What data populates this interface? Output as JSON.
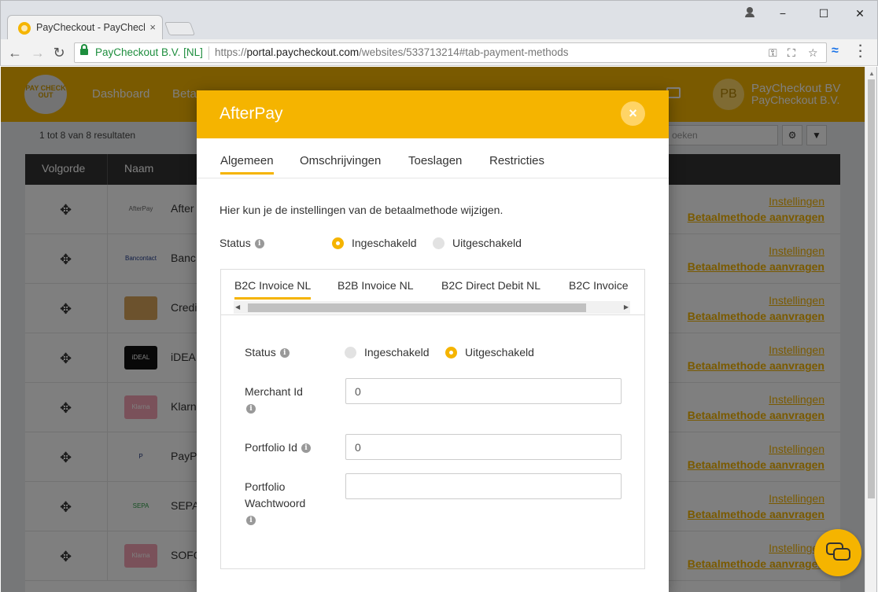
{
  "browser": {
    "tab_title": "PayCheckout - PayCheckout",
    "tab_close": "×",
    "secure_label": "PayCheckout B.V. [NL]",
    "url_scheme": "https://",
    "url_host": "portal.paycheckout.com",
    "url_path": "/websites/533713214#tab-payment-methods",
    "window_min": "−",
    "window_max": "☐",
    "window_close": "✕"
  },
  "app": {
    "logo_text": "PAY CHECK OUT",
    "nav": [
      "Dashboard",
      "Beta"
    ],
    "user_initials": "PB",
    "user_name": "PayCheckout BV",
    "user_company": "PayCheckout B.V.",
    "results_text": "1 tot 8 van 8 resultaten",
    "search_placeholder": "oeken",
    "table": {
      "headers": [
        "Volgorde",
        "Naam"
      ],
      "rows": [
        {
          "logo": "AfterPay",
          "name": "After",
          "color": "#ffffff",
          "text_color": "#6b6b6b",
          "link1": "Instellingen",
          "link2": "Betaalmethode aanvragen"
        },
        {
          "logo": "Bancontact",
          "name": "Banc",
          "color": "#ffffff",
          "text_color": "#1f3a8a",
          "link1": "Instellingen",
          "link2": "Betaalmethode aanvragen"
        },
        {
          "logo": "",
          "name": "Credi",
          "color": "#d8a55a",
          "text_color": "#ffffff",
          "link1": "Instellingen",
          "link2": "Betaalmethode aanvragen"
        },
        {
          "logo": "iDEAL",
          "name": "iDEAL",
          "color": "#111111",
          "text_color": "#ffffff",
          "link1": "Instellingen",
          "link2": "Betaalmethode aanvragen"
        },
        {
          "logo": "Klarna",
          "name": "Klarn",
          "color": "#f4a3b4",
          "text_color": "#ffffff",
          "link1": "Instellingen",
          "link2": "Betaalmethode aanvragen"
        },
        {
          "logo": "P",
          "name": "PayPa",
          "color": "#ffffff",
          "text_color": "#253b80",
          "link1": "Instellingen",
          "link2": "Betaalmethode aanvragen"
        },
        {
          "logo": "SEPA",
          "name": "SEPA",
          "color": "#ffffff",
          "text_color": "#2e9e47",
          "link1": "Instellingen",
          "link2": "Betaalmethode aanvragen"
        },
        {
          "logo": "Klarna",
          "name": "SOFO",
          "color": "#f4a3b4",
          "text_color": "#ffffff",
          "link1": "Instellingen",
          "link2": "Betaalmethode aanvragen"
        }
      ]
    }
  },
  "modal": {
    "title": "AfterPay",
    "close": "×",
    "tabs": [
      "Algemeen",
      "Omschrijvingen",
      "Toeslagen",
      "Restricties"
    ],
    "intro": "Hier kun je de instellingen van de betaalmethode wijzigen.",
    "status_label": "Status",
    "enabled_label": "Ingeschakeld",
    "disabled_label": "Uitgeschakeld",
    "status_value": "Ingeschakeld",
    "sub_tabs": [
      "B2C Invoice NL",
      "B2B Invoice NL",
      "B2C Direct Debit NL",
      "B2C Invoice"
    ],
    "sub": {
      "status_label": "Status",
      "enabled_label": "Ingeschakeld",
      "disabled_label": "Uitgeschakeld",
      "status_value": "Uitgeschakeld",
      "merchant_id_label": "Merchant Id",
      "merchant_id_value": "0",
      "portfolio_id_label": "Portfolio Id",
      "portfolio_id_value": "0",
      "portfolio_password_label_1": "Portfolio",
      "portfolio_password_label_2": "Wachtwoord",
      "portfolio_password_value": ""
    }
  },
  "colors": {
    "brand": "#f5b400",
    "header_dark": "#333333"
  }
}
